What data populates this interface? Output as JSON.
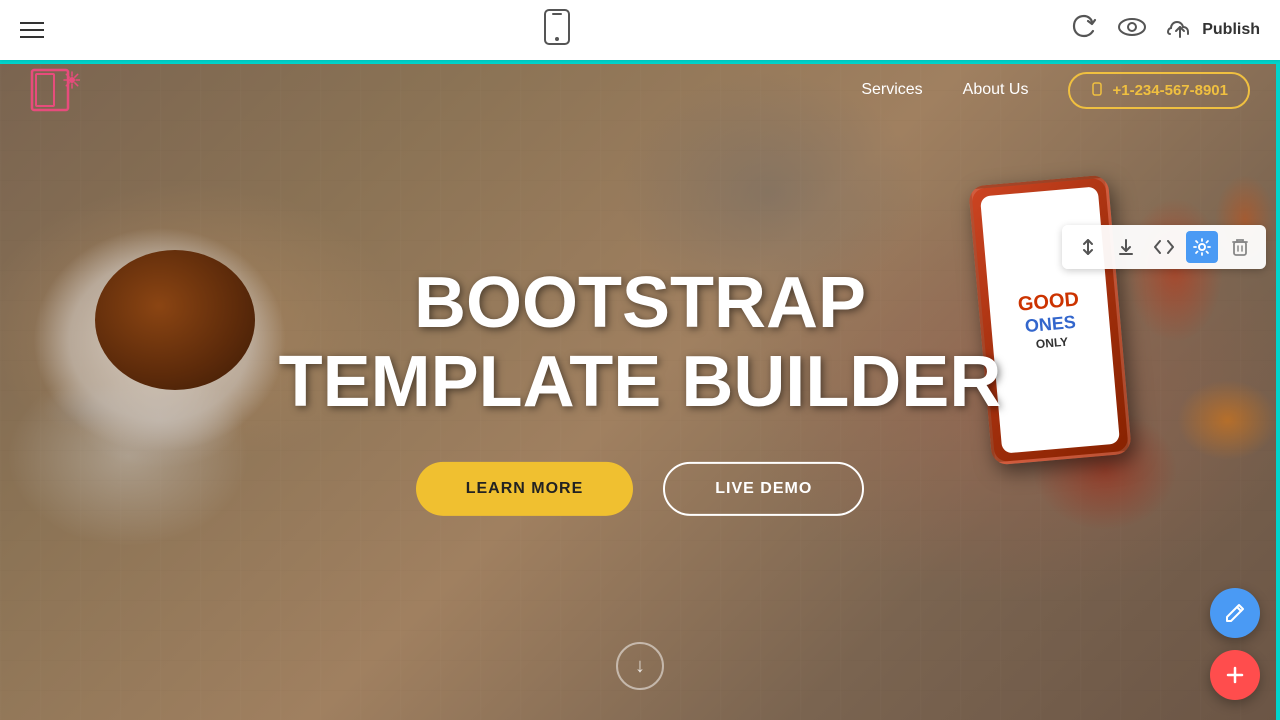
{
  "toolbar": {
    "publish_label": "Publish",
    "hamburger_label": "Menu"
  },
  "site_nav": {
    "links": [
      {
        "label": "Services",
        "href": "#"
      },
      {
        "label": "About Us",
        "href": "#"
      }
    ],
    "phone_number": "+1-234-567-8901"
  },
  "hero": {
    "title_line1": "BOOTSTRAP",
    "title_line2": "TEMPLATE BUILDER",
    "btn_learn": "LEARN MORE",
    "btn_demo": "LIVE DEMO"
  },
  "phone_mock": {
    "line1": "GOOD",
    "line2": "ONES",
    "line3": "ONLY"
  },
  "section_tools": [
    {
      "name": "reorder",
      "icon": "⇅"
    },
    {
      "name": "download",
      "icon": "↓"
    },
    {
      "name": "code",
      "icon": "</>"
    },
    {
      "name": "settings",
      "icon": "⚙"
    },
    {
      "name": "delete",
      "icon": "🗑"
    }
  ],
  "fab": {
    "edit_icon": "✏",
    "add_icon": "+"
  }
}
